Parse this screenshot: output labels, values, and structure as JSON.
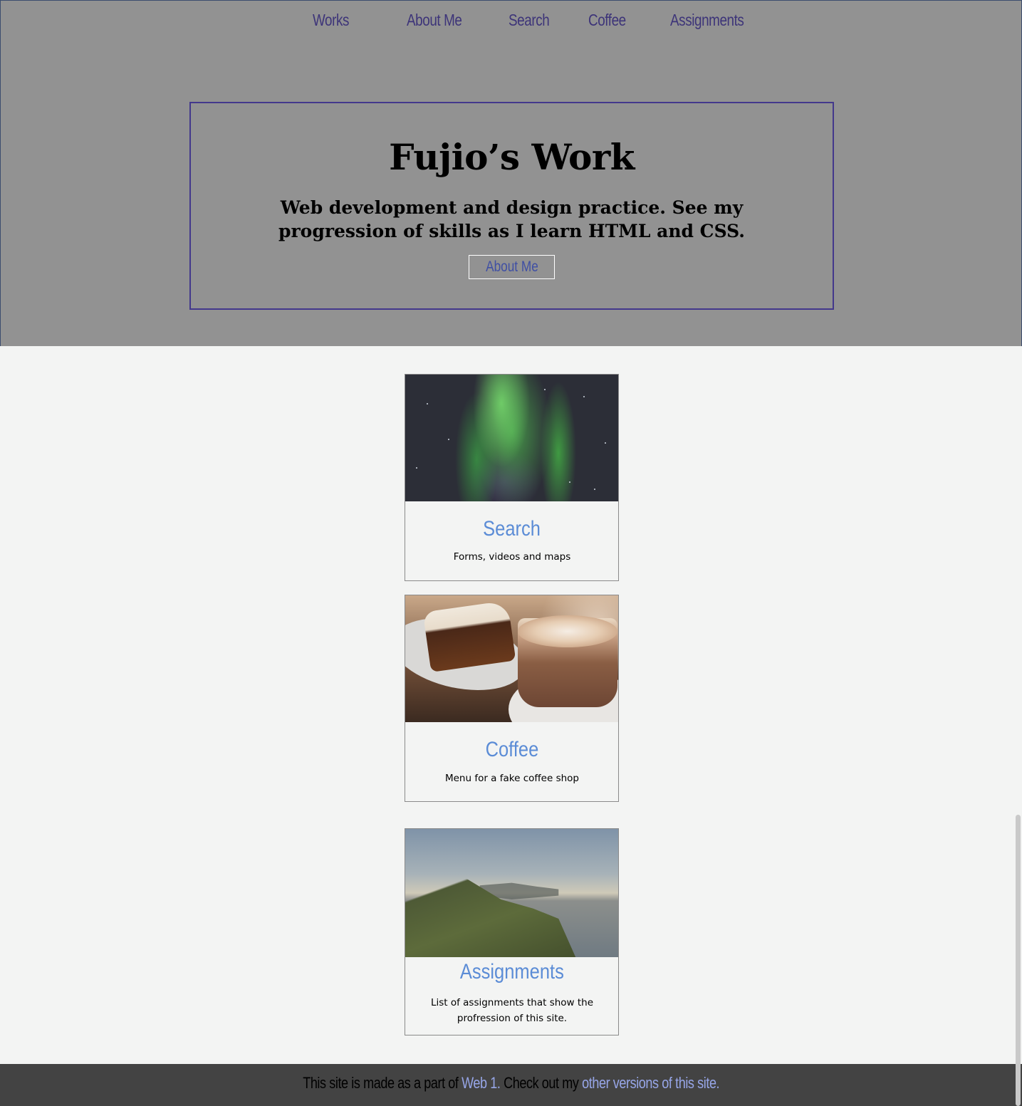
{
  "nav": {
    "items": [
      {
        "label": "Works"
      },
      {
        "label": "About Me"
      },
      {
        "label": "Search"
      },
      {
        "label": "Coffee"
      },
      {
        "label": "Assignments"
      }
    ]
  },
  "hero": {
    "title": "Fujio’s Work",
    "subtitle": "Web development and design practice. See my progression of skills as I learn HTML and CSS.",
    "button_label": "About Me"
  },
  "cards": [
    {
      "title": "Search",
      "text": "Forms, videos and maps",
      "image": "aurora-photo"
    },
    {
      "title": "Coffee",
      "text": "Menu for a fake coffee shop",
      "image": "coffee-photo"
    },
    {
      "title": "Assignments",
      "text": "List of assignments that show the profression of this site.",
      "image": "coastal-landscape-photo"
    }
  ],
  "footer": {
    "prefix": "This site is made as a part of",
    "link1": "Web 1.",
    "middle": "Check out my",
    "link2": "other versions of this site."
  },
  "colors": {
    "hero_bg": "#929292",
    "nav_link": "#3d3479",
    "hero_border": "#43388c",
    "card_title": "#5b8cd6",
    "footer_bg": "#434343",
    "footer_link": "#97a6e8",
    "page_bg": "#f3f4f3"
  }
}
